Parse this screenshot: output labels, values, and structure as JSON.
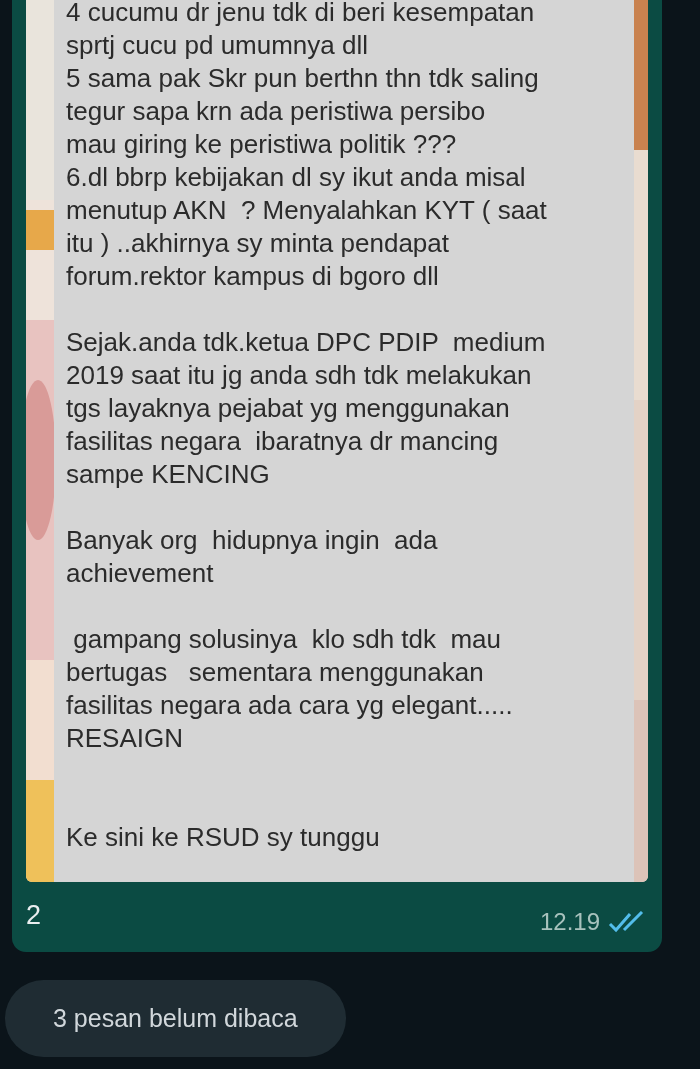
{
  "message": {
    "image_text": [
      {
        "kind": "paragraph",
        "lines": [
          "4 cucumu dr jenu tdk di beri kesempatan",
          "sprtj cucu pd umumnya dll",
          "5 sama pak Skr pun berthn thn tdk saling",
          "tegur sapa krn ada peristiwa persibo",
          "mau giring ke peristiwa politik ???",
          "6.dl bbrp kebijakan dl sy ikut anda misal",
          "menutup AKN  ? Menyalahkan KYT ( saat",
          "itu ) ..akhirnya sy minta pendapat",
          "forum.rektor kampus di bgoro dll"
        ]
      },
      {
        "kind": "blank"
      },
      {
        "kind": "paragraph",
        "lines": [
          "Sejak.anda tdk.ketua DPC PDIP  medium",
          "2019 saat itu jg anda sdh tdk melakukan",
          "tgs layaknya pejabat yg menggunakan",
          "fasilitas negara  ibaratnya dr mancing",
          "sampe KENCING"
        ]
      },
      {
        "kind": "blank"
      },
      {
        "kind": "paragraph",
        "lines": [
          "Banyak org  hidupnya ingin  ada",
          "achievement"
        ]
      },
      {
        "kind": "blank"
      },
      {
        "kind": "paragraph",
        "lines": [
          " gampang solusinya  klo sdh tdk  mau",
          "bertugas   sementara menggunakan",
          "fasilitas negara ada cara yg elegant.....",
          "RESAIGN"
        ]
      },
      {
        "kind": "blank"
      },
      {
        "kind": "blank"
      },
      {
        "kind": "paragraph",
        "lines": [
          "Ke sini ke RSUD sy tunggu"
        ]
      }
    ],
    "caption": "2",
    "time": "12.19",
    "read": true
  },
  "unread_banner": "3 pesan belum dibaca"
}
